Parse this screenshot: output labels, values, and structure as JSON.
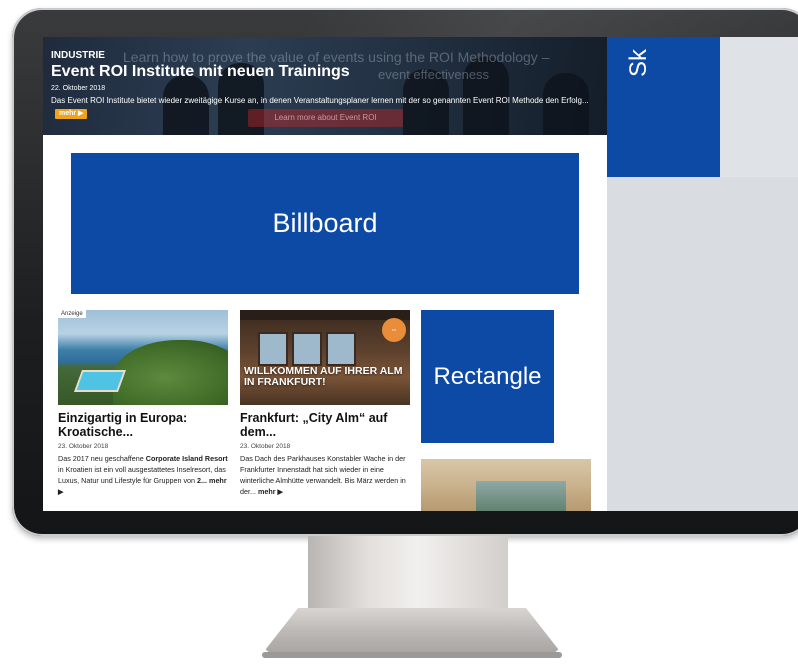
{
  "hero": {
    "category": "INDUSTRIE",
    "title": "Event ROI Institute mit neuen Trainings",
    "date": "22. Oktober 2018",
    "text": "Das Event ROI Institute bietet wieder zweitägige Kurse an, in denen Veranstaltungsplaner lernen mit der so genannten Event ROI Methode den Erfolg...",
    "more_label": "mehr ▶",
    "background_text_1": "Learn how to prove the value of events using the ROI Methodology –",
    "background_text_2": "event effectiveness",
    "background_button": "Learn more about Event ROI"
  },
  "ads": {
    "billboard": "Billboard",
    "rectangle": "Rectangle",
    "skyscraper": "Sk",
    "color": "#0c4aa6"
  },
  "cards": [
    {
      "badge": "Anzeige",
      "title": "Einzigartig in Europa: Kroatische...",
      "date": "23. Oktober 2018",
      "text_before": "Das 2017 neu geschaffene ",
      "text_bold": "Corporate Island Resort",
      "text_after": " in Kroatien ist ein voll ausgestattetes Inselresort, das Luxus, Natur und Lifestyle für Gruppen von ",
      "text_end_bold": "2...",
      "more_label": "mehr ▶"
    },
    {
      "image_caption": "WILLKOMMEN AUF IHRER ALM IN FRANKFURT!",
      "title": "Frankfurt: „City Alm“ auf dem...",
      "date": "23. Oktober 2018",
      "text": "Das Dach des Parkhauses Konstabler Wache in der Frankfurter Innenstadt hat sich wieder in eine winterliche Almhütte verwandelt. Bis März werden in der...",
      "more_label": "mehr ▶"
    }
  ],
  "accent_color": "#f0a21c"
}
